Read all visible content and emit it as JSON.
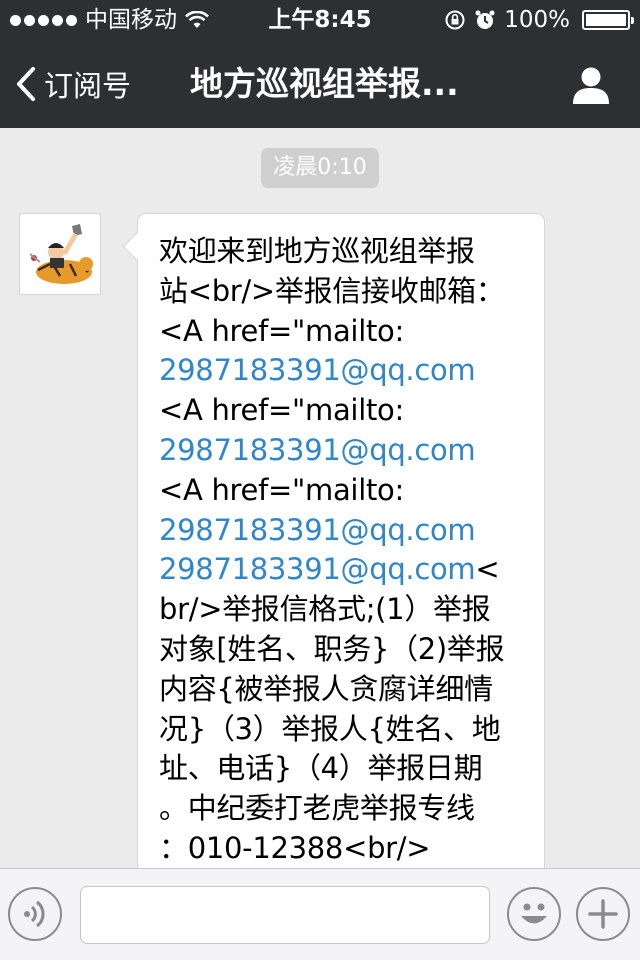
{
  "status_bar": {
    "carrier": "中国移动",
    "time": "上午8:45",
    "battery_text": "100%",
    "battery_level": 1.0
  },
  "nav": {
    "back_label": "订阅号",
    "title": "地方巡视组举报..."
  },
  "chat": {
    "timestamp": "凌晨0:10",
    "message_lines": [
      {
        "text": "欢迎来到地方巡视组举报",
        "link": false
      },
      {
        "text": "站<br/>举报信接收邮箱：",
        "link": false
      },
      {
        "text": "<A href=\"mailto:",
        "link": false
      },
      {
        "text": "2987183391@qq.com",
        "link": true
      },
      {
        "text": "<A href=\"mailto:",
        "link": false
      },
      {
        "text": "2987183391@qq.com",
        "link": true
      },
      {
        "text": "<A href=\"mailto:",
        "link": false
      },
      {
        "text": "2987183391@qq.com",
        "link": true
      }
    ],
    "line9_link": "2987183391@qq.com",
    "line9_rest": "<",
    "message_tail_lines": [
      "br/>举报信格式;(1）举报",
      "对象[姓名、职务}（2)举报",
      "内容{被举报人贪腐详细情",
      "况}（3）举报人{姓名、地",
      "址、电话}（4）举报日期",
      "。中纪委打老虎举报专线",
      "：010-12388<br/>"
    ]
  },
  "icons": {
    "signal": "signal-dots-icon",
    "wifi": "wifi-icon",
    "lock_rotation": "rotation-lock-icon",
    "alarm": "alarm-icon",
    "battery": "battery-icon",
    "back": "chevron-left-icon",
    "profile": "person-icon",
    "voice": "voice-icon",
    "emoji": "emoji-icon",
    "plus": "plus-icon"
  },
  "colors": {
    "nav_bg": "#2d3033",
    "link": "#2f87c9",
    "chat_bg": "#ebebeb"
  }
}
